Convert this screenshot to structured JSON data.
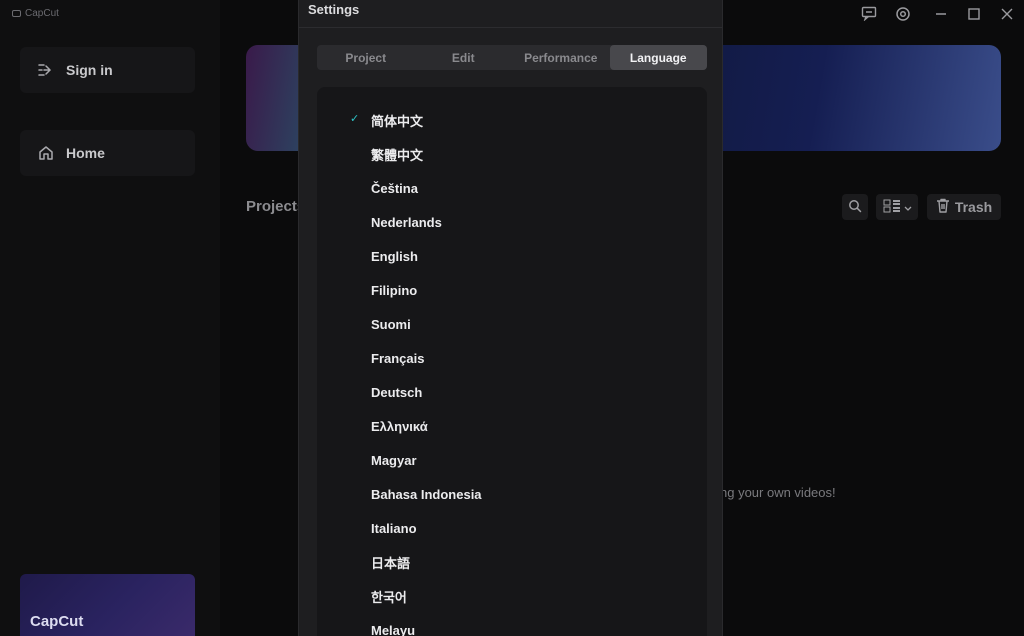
{
  "app": {
    "name": "CapCut"
  },
  "sidebar": {
    "sign_in": "Sign in",
    "home": "Home",
    "promo_label": "CapCut"
  },
  "main": {
    "projects_title": "Projects",
    "trash_label": "Trash",
    "empty_hint": "ng your own videos!"
  },
  "settings": {
    "title": "Settings",
    "tabs": [
      {
        "label": "Project"
      },
      {
        "label": "Edit"
      },
      {
        "label": "Performance"
      },
      {
        "label": "Language"
      }
    ],
    "active_tab": "Language",
    "selected_language": "简体中文",
    "languages": [
      "简体中文",
      "繁體中文",
      "Čeština",
      "Nederlands",
      "English",
      "Filipino",
      "Suomi",
      "Français",
      "Deutsch",
      "Ελληνικά",
      "Magyar",
      "Bahasa Indonesia",
      "Italiano",
      "日本語",
      "한국어",
      "Melayu"
    ]
  },
  "colors": {
    "accent_check": "#2ec4c7"
  },
  "icons": {
    "sign_in": "sign-in-icon",
    "home": "home-icon",
    "search": "search-icon",
    "view": "grid-view-icon",
    "trash": "trash-icon",
    "feedback": "feedback-icon",
    "settings": "gear-icon"
  }
}
